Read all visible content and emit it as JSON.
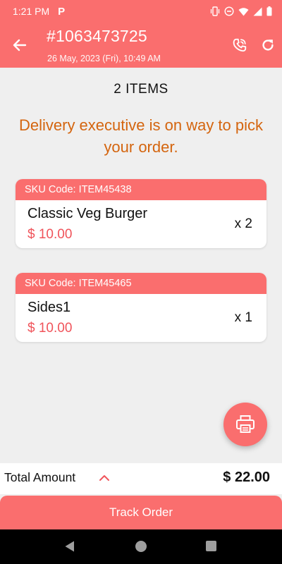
{
  "status_bar": {
    "time": "1:21 PM",
    "app_icon": "P",
    "icons": [
      "vibrate-icon",
      "do-not-disturb-icon",
      "wifi-icon",
      "signal-icon",
      "battery-icon"
    ]
  },
  "header": {
    "order_id": "#1063473725",
    "date": "26 May, 2023 (Fri), 10:49 AM",
    "icons": [
      "back-arrow-icon",
      "phone-call-icon",
      "refresh-icon"
    ]
  },
  "summary": {
    "items_count": "2 ITEMS",
    "status_message": "Delivery executive is on way to pick your order."
  },
  "items": [
    {
      "sku": "SKU Code: ITEM45438",
      "name": "Classic Veg Burger",
      "price": "$ 10.00",
      "qty": "x 2"
    },
    {
      "sku": "SKU Code: ITEM45465",
      "name": "Sides1",
      "price": "$ 10.00",
      "qty": "x 1"
    }
  ],
  "footer": {
    "total_label": "Total Amount",
    "total_value": "$ 22.00",
    "track_button": "Track Order"
  },
  "colors": {
    "primary": "#fa6e6e",
    "status_text": "#d4650f",
    "price": "#f0545b"
  }
}
